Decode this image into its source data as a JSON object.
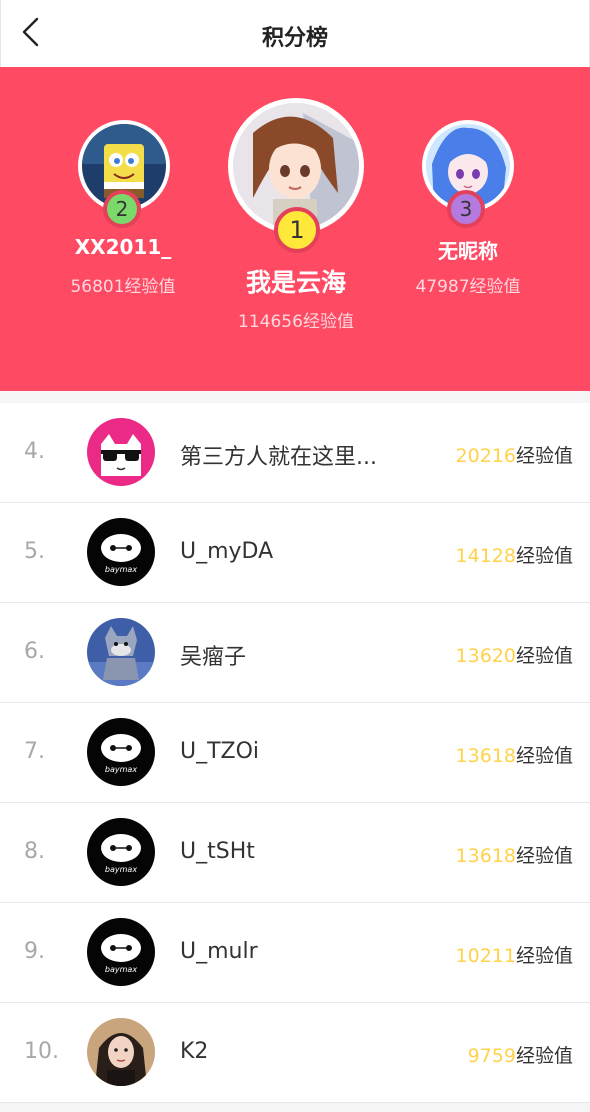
{
  "header": {
    "title": "积分榜"
  },
  "podium": [
    {
      "rank": "2",
      "name": "XX2011_",
      "score": "56801经验值",
      "avatar": "spongebob-avatar",
      "badge_color": "#7bd86a"
    },
    {
      "rank": "1",
      "name": "我是云海",
      "score": "114656经验值",
      "avatar": "anime-girl-avatar",
      "badge_color": "#ffe83a"
    },
    {
      "rank": "3",
      "name": "无昵称",
      "score": "47987经验值",
      "avatar": "blue-hair-avatar",
      "badge_color": "#b57ae0"
    }
  ],
  "score_unit": "经验值",
  "list": [
    {
      "rank": "4.",
      "name": "第三方人就在这里...",
      "score": "20216",
      "avatar": "cat-sunglasses-avatar"
    },
    {
      "rank": "5.",
      "name": "U_myDA",
      "score": "14128",
      "avatar": "baymax-avatar"
    },
    {
      "rank": "6.",
      "name": "吴瘤子",
      "score": "13620",
      "avatar": "tom-cat-avatar"
    },
    {
      "rank": "7.",
      "name": "U_TZOi",
      "score": "13618",
      "avatar": "baymax-avatar"
    },
    {
      "rank": "8.",
      "name": "U_tSHt",
      "score": "13618",
      "avatar": "baymax-avatar"
    },
    {
      "rank": "9.",
      "name": "U_mulr",
      "score": "10211",
      "avatar": "baymax-avatar"
    },
    {
      "rank": "10.",
      "name": "K2",
      "score": "9759",
      "avatar": "portrait-avatar"
    }
  ],
  "colors": {
    "banner": "#ff4a64",
    "score_highlight": "#ffd24a"
  }
}
